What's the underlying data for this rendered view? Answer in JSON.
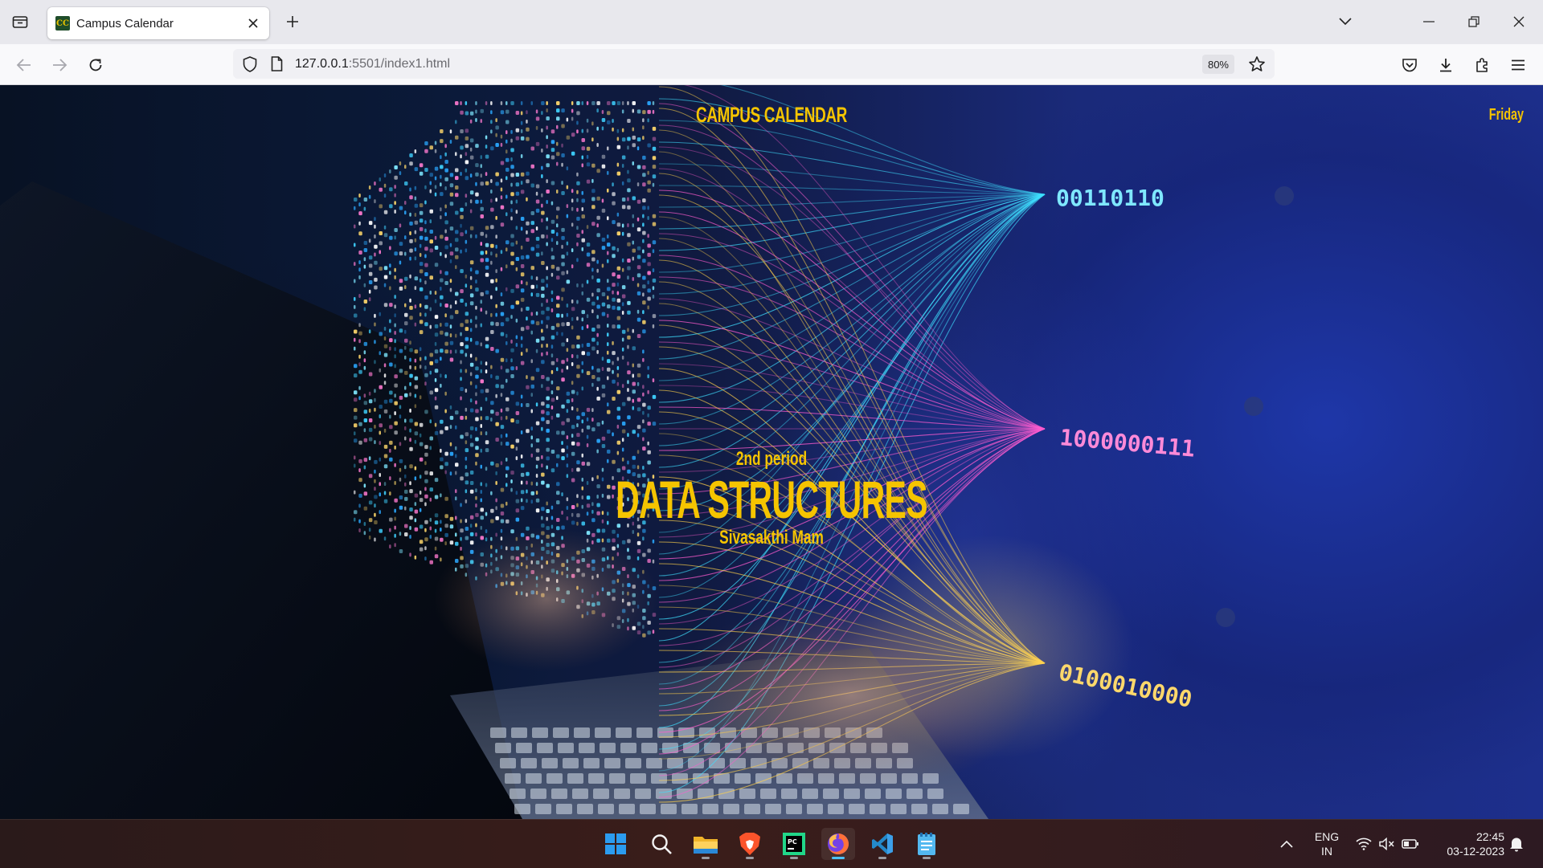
{
  "browser": {
    "tab_title": "Campus Calendar",
    "url_host": "127.0.0.1",
    "url_rest": ":5501/index1.html",
    "zoom": "80%"
  },
  "page": {
    "title": "CAMPUS CALENDAR",
    "day": "Friday",
    "period": "2nd period",
    "subject": "DATA STRUCTURES",
    "teacher": "Sivasakthi Mam",
    "binary_1": "00110110",
    "binary_2": "1000000111",
    "binary_3": "0100010000",
    "accent_color": "#f5c400"
  },
  "taskbar": {
    "language_1": "ENG",
    "language_2": "IN",
    "time": "22:45",
    "date": "03-12-2023",
    "apps": [
      "start-icon",
      "search-icon",
      "file-explorer-icon",
      "brave-icon",
      "pycharm-icon",
      "firefox-icon",
      "vscode-icon",
      "notepad-icon"
    ]
  }
}
